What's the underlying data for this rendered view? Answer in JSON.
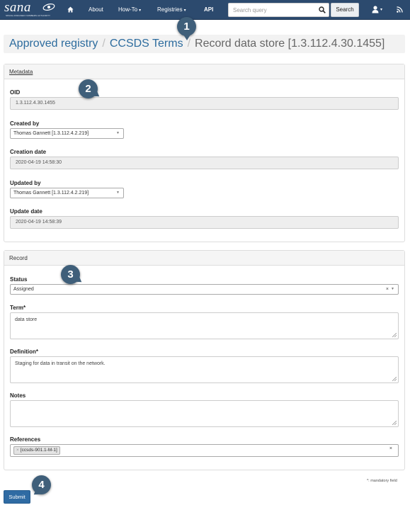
{
  "navbar": {
    "logo_word": "sana",
    "logo_tagline": "SPACE ASSIGNED NUMBERS AUTHORITY",
    "about": "About",
    "how_to": "How-To",
    "registries": "Registries",
    "api": "API",
    "search_placeholder": "Search query",
    "search_button": "Search",
    "colors": {
      "bar": "#2c4a6e",
      "link": "#2d6c9e",
      "submit": "#2f6ba3"
    }
  },
  "breadcrumb": {
    "items": [
      "Approved registry",
      "CCSDS Terms"
    ],
    "separator": "/",
    "active": "Record data store [1.3.112.4.30.1455]"
  },
  "metadata": {
    "heading": "Metadata",
    "oid_label": "OID",
    "oid_value": "1.3.112.4.30.1455",
    "created_by_label": "Created by",
    "created_by_value": "Thomas Gannett [1.3.112.4.2.219]",
    "creation_date_label": "Creation date",
    "creation_date_value": "2020-04-19 14:58:30",
    "updated_by_label": "Updated by",
    "updated_by_value": "Thomas Gannett [1.3.112.4.2.219]",
    "update_date_label": "Update date",
    "update_date_value": "2020-04-19 14:58:39"
  },
  "record": {
    "heading": "Record",
    "status_label": "Status",
    "status_value": "Assigned",
    "term_label": "Term*",
    "term_value": "data store",
    "definition_label": "Definition*",
    "definition_value": "Staging for data in transit on the network.",
    "notes_label": "Notes",
    "notes_value": "",
    "references_label": "References",
    "references_chip": "[ccsds-901.1-M-1]",
    "clear_symbol": "×"
  },
  "footer": {
    "mandatory_note": "*: mandatory field",
    "submit": "Submit"
  },
  "markers": [
    "1",
    "2",
    "3",
    "4"
  ]
}
